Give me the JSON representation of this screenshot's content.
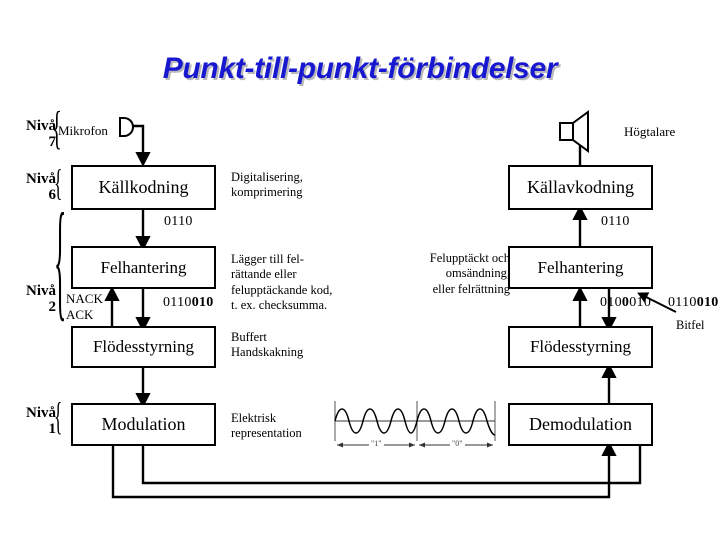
{
  "title": "Punkt-till-punkt-förbindelser",
  "title_color": "#1818d0",
  "levels": [
    {
      "id": "7",
      "word": "Nivå",
      "num": "7"
    },
    {
      "id": "6",
      "word": "Nivå",
      "num": "6"
    },
    {
      "id": "2",
      "word": "Nivå",
      "num": "2"
    },
    {
      "id": "1",
      "word": "Nivå",
      "num": "1"
    }
  ],
  "endpoints": {
    "microphone_label": "Mikrofon",
    "speaker_label": "Högtalare"
  },
  "boxes": {
    "kallkodning": "Källkodning",
    "kallavkodning": "Källavkodning",
    "felhantering_left": "Felhantering",
    "felhantering_right": "Felhantering",
    "flodesstyrning_left": "Flödesstyrning",
    "flodesstyrning_right": "Flödesstyrning",
    "modulation": "Modulation",
    "demodulation": "Demodulation"
  },
  "notes": {
    "level6": "Digitalisering,\nkomprimering",
    "level2_error": "Lägger till fel-\nrättande eller\nfelupptäckande kod,\nt. ex. checksumma.",
    "level2_flow": "Buffert\nHandskakning",
    "level2_right": "Felupptäckt och\nomsändning,\neller felrättning",
    "level1": "Elektrisk\nrepresentation"
  },
  "bits": {
    "left_top": "0110",
    "right_top": "0110",
    "left_mid_plain": "0110",
    "left_mid_bold": "010",
    "right_mid_a_pre": "010",
    "right_mid_a_bold": "0",
    "right_mid_a_post": "010",
    "right_mid_b_plain": "0110",
    "right_mid_b_bold": "010",
    "bitfel_label": "Bitfel"
  },
  "ack": {
    "nack": "NACK",
    "ack": "ACK"
  },
  "waveform": {
    "type": "line",
    "title": "",
    "xlabel": "",
    "ylabel": "",
    "symbol_labels": [
      "\"1\"",
      "\"0\""
    ],
    "description": "Two sine-burst symbol intervals; left interval labelled \"1\", right interval labelled \"0\"",
    "series": [
      {
        "name": "carrier",
        "cycles_per_symbol": 2.5,
        "amplitude": 1.0,
        "symbols": 2
      }
    ]
  }
}
